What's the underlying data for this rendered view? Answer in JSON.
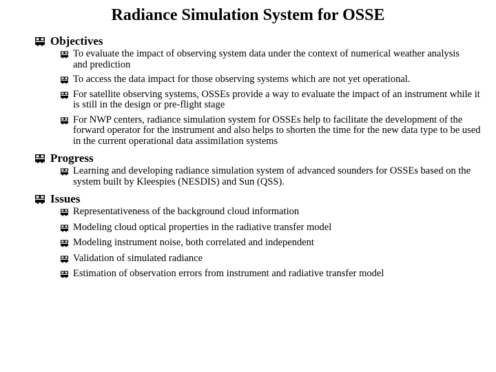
{
  "slide": {
    "title": "Radiance Simulation System for OSSE",
    "bullet_icon": "bus-icon",
    "background_color": "#ffffff",
    "text_color": "#000000",
    "sections": [
      {
        "heading": "Objectives",
        "items": [
          "To evaluate the impact of observing system data under the context of numerical weather analysis and prediction",
          "To access the data impact for those observing systems which are not yet operational.",
          "For satellite observing systems, OSSEs provide a way to evaluate the impact of an instrument while it is still in the design or pre-flight stage",
          "For NWP centers, radiance simulation system for OSSEs help to facilitate the development of the forward operator for the instrument and also helps to shorten the time for the new data type to be used in the current operational data assimilation systems"
        ]
      },
      {
        "heading": "Progress",
        "items": [
          "Learning and developing radiance simulation system of advanced sounders for OSSEs based on the system built by Kleespies (NESDIS) and Sun (QSS)."
        ]
      },
      {
        "heading": "Issues",
        "items": [
          "Representativeness of the background cloud information",
          "Modeling cloud optical properties in the radiative transfer model",
          "Modeling instrument noise, both correlated and independent",
          "Validation of simulated radiance",
          "Estimation of observation errors from instrument and radiative transfer model"
        ]
      }
    ]
  }
}
